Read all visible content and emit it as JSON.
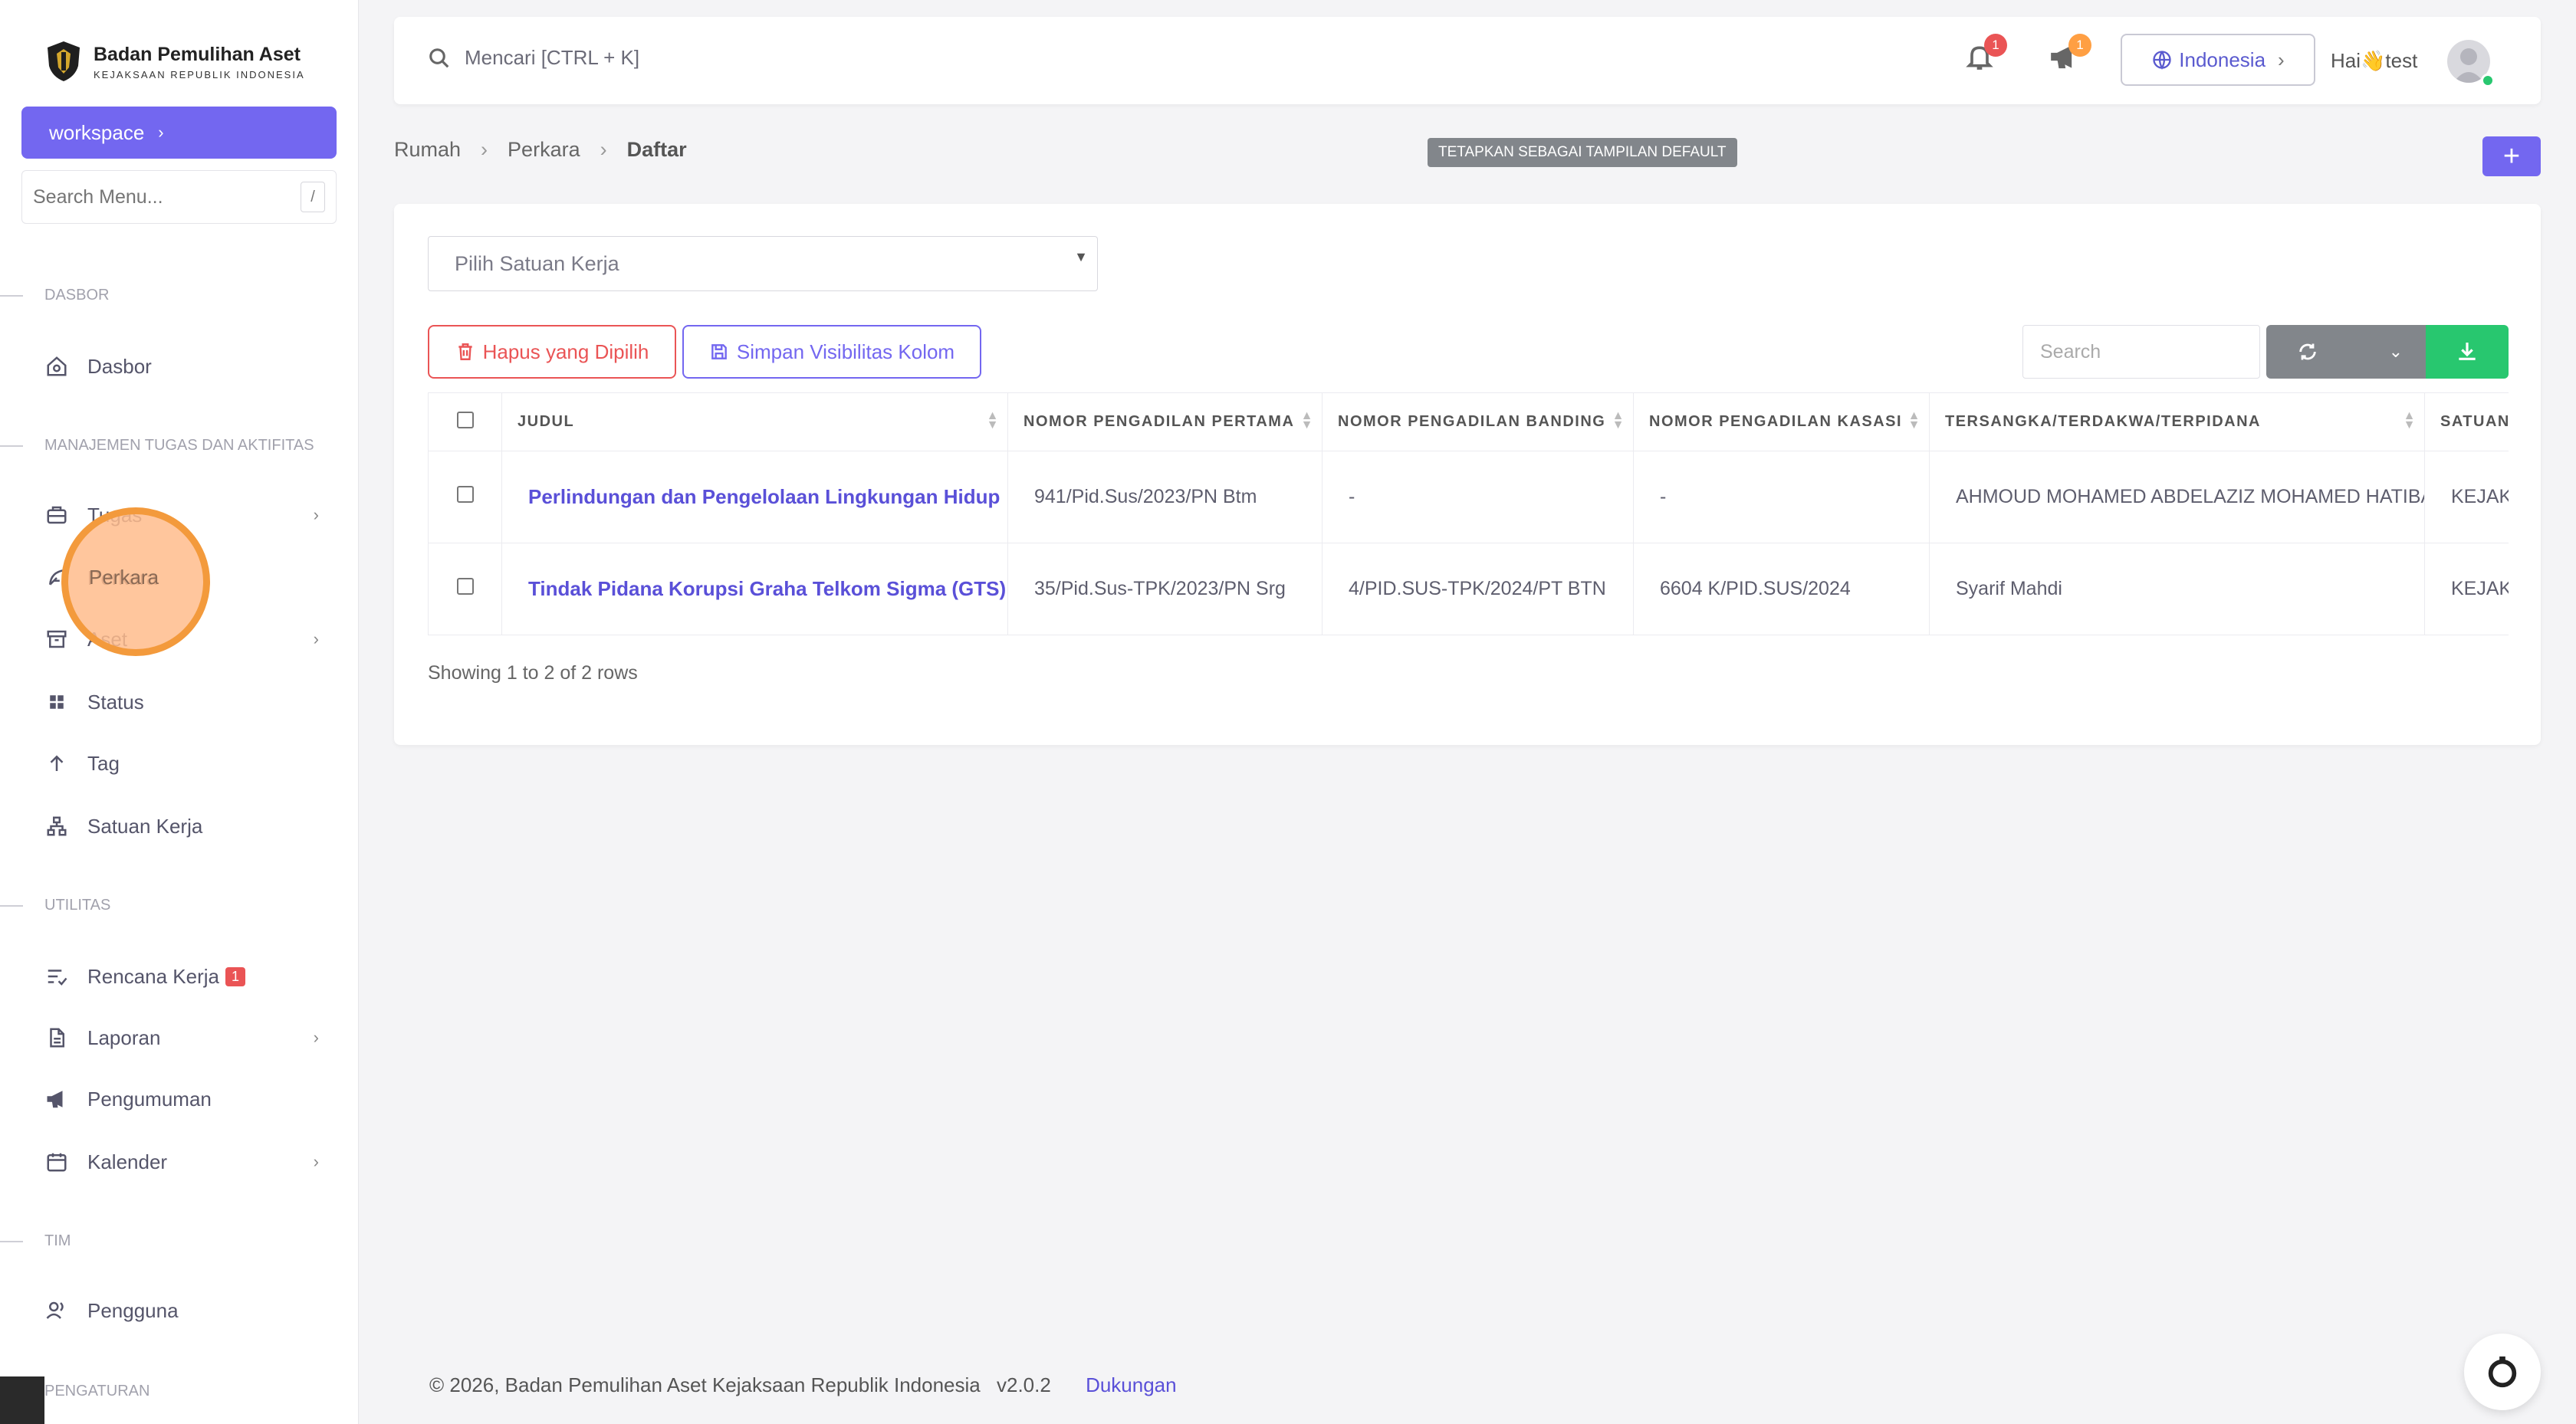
{
  "brand": {
    "title": "Badan Pemulihan Aset",
    "subtitle": "KEJAKSAAN REPUBLIK INDONESIA"
  },
  "sidebar": {
    "workspace_label": "workspace",
    "search_placeholder": "Search Menu...",
    "search_shortcut": "/",
    "sections": {
      "dasbor": "DASBOR",
      "manajemen": "MANAJEMEN TUGAS DAN AKTIFITAS",
      "utilitas": "UTILITAS",
      "tim": "TIM",
      "pengaturan": "PENGATURAN"
    },
    "items": {
      "dasbor": "Dasbor",
      "tugas": "Tugas",
      "perkara": "Perkara",
      "aset": "Aset",
      "status": "Status",
      "tag": "Tag",
      "satuan_kerja": "Satuan Kerja",
      "rencana_kerja": "Rencana Kerja",
      "rencana_kerja_badge": "1",
      "laporan": "Laporan",
      "pengumuman": "Pengumuman",
      "kalender": "Kalender",
      "pengguna": "Pengguna"
    }
  },
  "topbar": {
    "search_placeholder": "Mencari [CTRL + K]",
    "notif_count": "1",
    "announce_count": "1",
    "language": "Indonesia",
    "greeting": "Hai👋test"
  },
  "breadcrumb": {
    "home": "Rumah",
    "parent": "Perkara",
    "current": "Daftar"
  },
  "default_view_label": "TETAPKAN SEBAGAI TAMPILAN DEFAULT",
  "toolbar": {
    "select_unit_placeholder": "Pilih Satuan Kerja",
    "delete_label": "Hapus yang Dipilih",
    "save_columns_label": "Simpan Visibilitas Kolom",
    "search_placeholder": "Search"
  },
  "table": {
    "headers": {
      "judul": "JUDUL",
      "pertama": "NOMOR PENGADILAN PERTAMA",
      "banding": "NOMOR PENGADILAN BANDING",
      "kasasi": "NOMOR PENGADILAN KASASI",
      "tersangka": "TERSANGKA/TERDAKWA/TERPIDANA",
      "satuan": "SATUAN"
    },
    "rows": [
      {
        "judul": "Perlindungan dan Pengelolaan Lingkungan Hidup",
        "pertama": "941/Pid.Sus/2023/PN Btm",
        "banding": "-",
        "kasasi": "-",
        "tersangka": "AHMOUD MOHAMED ABDELAZIZ MOHAMED HATIBA",
        "satuan": "KEJAK"
      },
      {
        "judul": "Tindak Pidana Korupsi Graha Telkom Sigma (GTS)",
        "pertama": "35/Pid.Sus-TPK/2023/PN Srg",
        "banding": "4/PID.SUS-TPK/2024/PT BTN",
        "kasasi": "6604 K/PID.SUS/2024",
        "tersangka": "Syarif Mahdi",
        "satuan": "KEJAK"
      }
    ],
    "showing": "Showing 1 to 2 of 2 rows"
  },
  "footer": {
    "copyright": "© 2026, Badan Pemulihan Aset Kejaksaan Republik Indonesia",
    "version": "v2.0.2",
    "support": "Dukungan"
  }
}
